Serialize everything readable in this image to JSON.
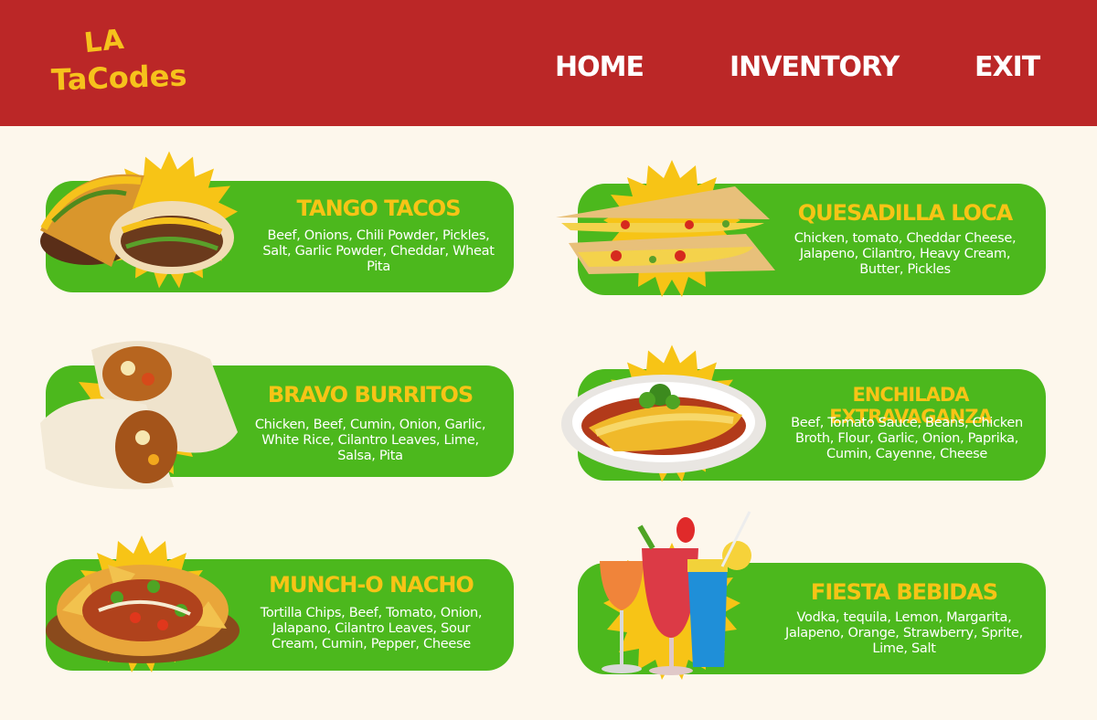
{
  "brand": {
    "line1": "LA",
    "line2": "TaCodes"
  },
  "nav": {
    "home": "HOME",
    "inventory": "INVENTORY",
    "exit": "EXIT"
  },
  "colors": {
    "header": "#bb2727",
    "card": "#4cb81d",
    "accent": "#f7c416",
    "background": "#fdf7ec"
  },
  "menu": [
    {
      "title": "TANGO TACOS",
      "description": "Beef, Onions, Chili Powder, Pickles, Salt, Garlic Powder, Cheddar, Wheat Pita",
      "icon": "taco-icon"
    },
    {
      "title": "QUESADILLA LOCA",
      "description": "Chicken, tomato, Cheddar Cheese, Jalapeno, Cilantro, Heavy Cream, Butter, Pickles",
      "icon": "quesadilla-icon"
    },
    {
      "title": "BRAVO BURRITOS",
      "description": "Chicken, Beef, Cumin, Onion, Garlic, White Rice, Cilantro Leaves, Lime, Salsa, Pita",
      "icon": "burrito-icon"
    },
    {
      "title": "ENCHILADA EXTRAVAGANZA",
      "description": "Beef, Tomato Sauce, Beans, Chicken Broth, Flour, Garlic, Onion, Paprika, Cumin, Cayenne, Cheese",
      "icon": "enchilada-icon"
    },
    {
      "title": "MUNCH-O NACHO",
      "description": "Tortilla Chips, Beef, Tomato, Onion, Jalapano, Cilantro Leaves, Sour Cream, Cumin, Pepper, Cheese",
      "icon": "nachos-icon"
    },
    {
      "title": "FIESTA BEBIDAS",
      "description": "Vodka, tequila, Lemon, Margarita, Jalapeno, Orange, Strawberry, Sprite, Lime, Salt",
      "icon": "cocktails-icon"
    }
  ]
}
